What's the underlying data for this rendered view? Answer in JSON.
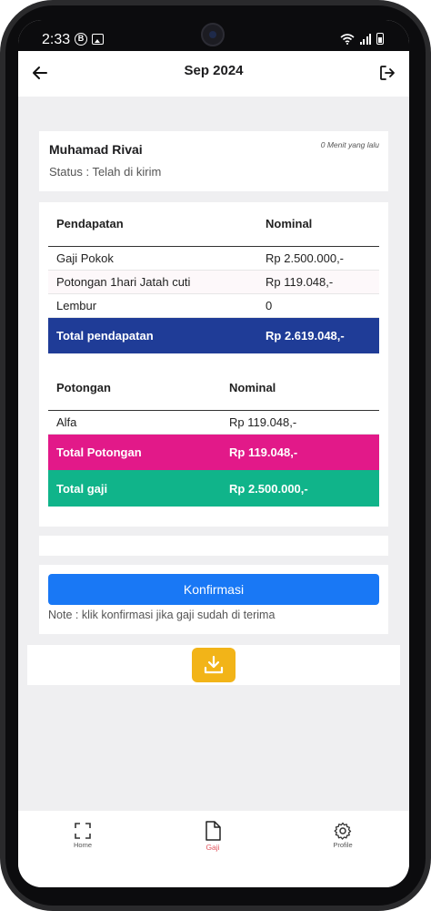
{
  "status_bar": {
    "time": "2:33",
    "b_badge": "B"
  },
  "header": {
    "title": "Sep 2024"
  },
  "employee": {
    "name": "Muhamad Rivai",
    "time_ago": "0 Menit yang lalu",
    "status": "Status : Telah di kirim"
  },
  "income": {
    "headers": [
      "Pendapatan",
      "Nominal"
    ],
    "rows": [
      {
        "label": "Gaji Pokok",
        "value": "Rp 2.500.000,-"
      },
      {
        "label": "Potongan 1hari Jatah cuti",
        "value": "Rp 119.048,-"
      },
      {
        "label": "Lembur",
        "value": "0"
      }
    ],
    "total_label": "Total pendapatan",
    "total_value": "Rp 2.619.048,-"
  },
  "deductions": {
    "headers": [
      "Potongan",
      "Nominal"
    ],
    "rows": [
      {
        "label": "Alfa",
        "value": "Rp 119.048,-"
      }
    ],
    "total_label": "Total Potongan",
    "total_value": "Rp 119.048,-"
  },
  "net": {
    "label": "Total gaji",
    "value": "Rp 2.500.000,-"
  },
  "confirm": {
    "button_label": "Konfirmasi",
    "note": "Note : klik konfirmasi jika gaji sudah di terima"
  },
  "download": {
    "icon": "download-icon"
  },
  "bottom_nav": {
    "items": [
      {
        "label": "Home",
        "icon": "scan-icon"
      },
      {
        "label": "Gaji",
        "icon": "document-icon",
        "active": true
      },
      {
        "label": "Profile",
        "icon": "gear-icon"
      }
    ]
  },
  "colors": {
    "total_income": "#1f3c97",
    "total_deduction": "#e21989",
    "total_net": "#10b48a",
    "confirm_button": "#1978f5",
    "download_button": "#f2b418",
    "nav_active": "#e2555e"
  }
}
